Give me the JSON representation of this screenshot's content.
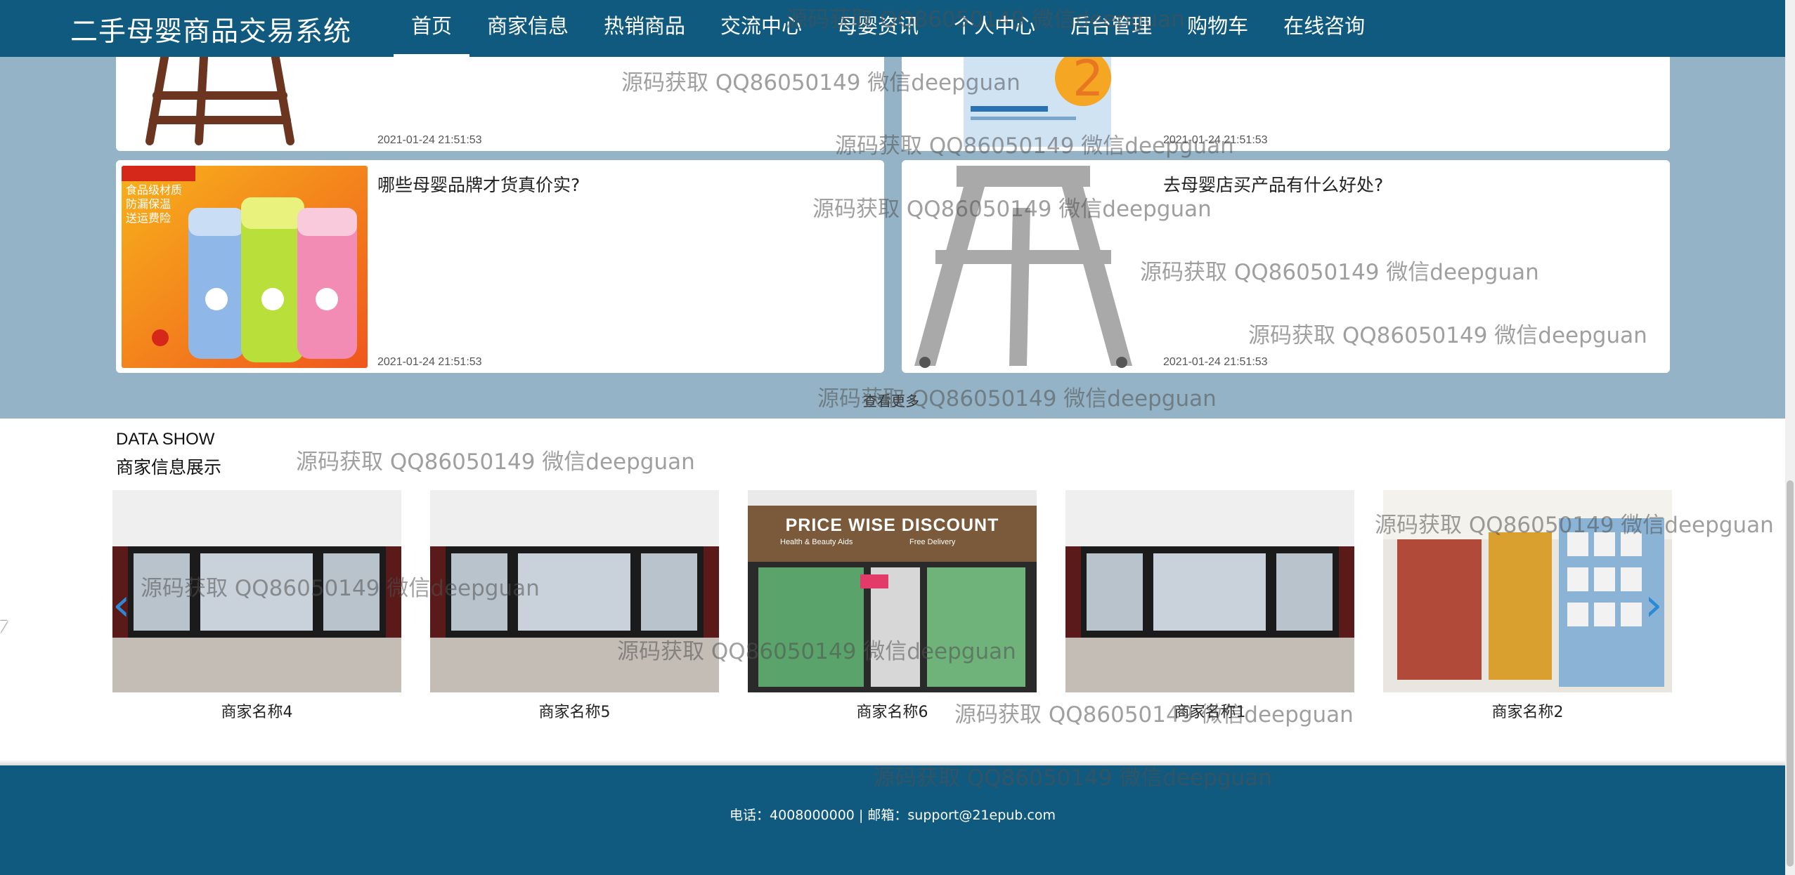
{
  "nav": {
    "brand": "二手母婴商品交易系统",
    "items": [
      {
        "label": "首页",
        "active": true
      },
      {
        "label": "商家信息"
      },
      {
        "label": "热销商品"
      },
      {
        "label": "交流中心"
      },
      {
        "label": "母婴资讯"
      },
      {
        "label": "个人中心"
      },
      {
        "label": "后台管理"
      },
      {
        "label": "购物车"
      },
      {
        "label": "在线咨询"
      }
    ]
  },
  "news": {
    "cards": [
      {
        "title": "",
        "date": "2021-01-24 21:51:53"
      },
      {
        "title": "",
        "date": "2021-01-24 21:51:53"
      },
      {
        "title": "哪些母婴品牌才货真价实?",
        "date": "2021-01-24 21:51:53"
      },
      {
        "title": "去母婴店买产品有什么好处?",
        "date": "2021-01-24 21:51:53"
      }
    ],
    "more_label": "查看更多"
  },
  "data_show": {
    "en_title": "DATA SHOW",
    "cn_title": "商家信息展示",
    "shops": [
      {
        "name": "商家名称4"
      },
      {
        "name": "商家名称5"
      },
      {
        "name": "商家名称6"
      },
      {
        "name": "商家名称1"
      },
      {
        "name": "商家名称2"
      }
    ],
    "sign_text": "PRICE WISE DISCOUNT",
    "sign_sub": "Health & Beauty Aids",
    "sign_sub2": "Free Delivery"
  },
  "footer": {
    "text": "电话：4008000000 | 邮箱：support@21epub.com"
  },
  "watermark": "源码获取 QQ86050149 微信deepguan",
  "colors": {
    "nav_bg": "#0f5a7e",
    "section_bg": "#94b3c6",
    "arrow": "#2b8ad6"
  }
}
